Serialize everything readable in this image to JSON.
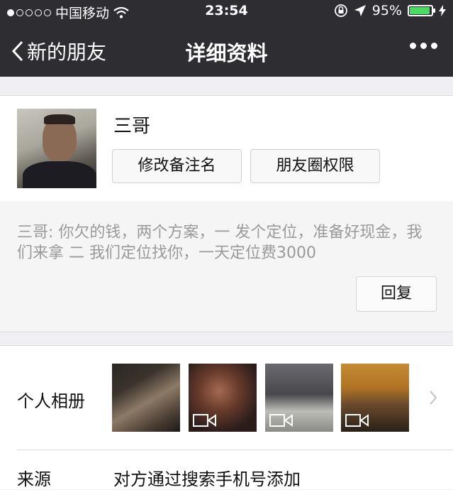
{
  "status_bar": {
    "carrier": "中国移动",
    "time": "23:54",
    "battery_percent": "95%",
    "battery_level": 0.95,
    "battery_color": "#4cd964",
    "icons": [
      "signal-dots-icon",
      "wifi-icon",
      "rotation-lock-icon",
      "location-arrow-icon",
      "battery-icon",
      "charging-icon"
    ]
  },
  "nav": {
    "back_label": "新的朋友",
    "title": "详细资料",
    "more_icon": "more-dots-icon",
    "background": "#2e2e32"
  },
  "profile": {
    "name": "三哥",
    "remark_button": "修改备注名",
    "moments_button": "朋友圈权限"
  },
  "message": {
    "text": "三哥: 你欠的钱，两个方案，一 发个定位，准备好现金，我们来拿 二  我们定位找你，一天定位费3000",
    "reply_button": "回复"
  },
  "album": {
    "label": "个人相册",
    "thumbnails": [
      {
        "name": "photo-1",
        "video": false
      },
      {
        "name": "photo-2",
        "video": true
      },
      {
        "name": "photo-3",
        "video": true
      },
      {
        "name": "photo-4",
        "video": true
      }
    ]
  },
  "source": {
    "label": "来源",
    "value": "对方通过搜索手机号添加"
  }
}
